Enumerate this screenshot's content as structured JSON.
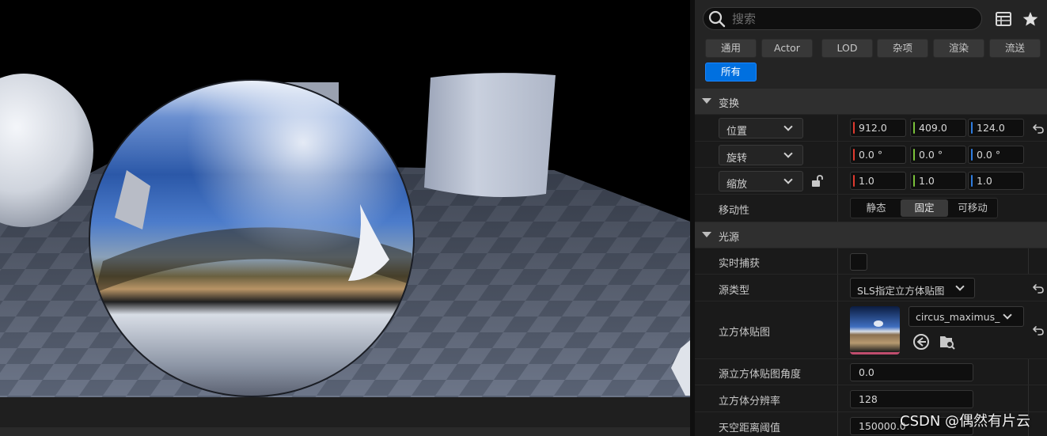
{
  "search": {
    "placeholder": "搜索"
  },
  "toolbar": {
    "table_icon": "table-view-icon",
    "favorite_icon": "star-icon"
  },
  "filters": [
    {
      "label": "通用",
      "active": false
    },
    {
      "label": "Actor",
      "active": false
    },
    {
      "label": "LOD",
      "active": false
    },
    {
      "label": "杂项",
      "active": false
    },
    {
      "label": "渲染",
      "active": false
    },
    {
      "label": "流送",
      "active": false
    },
    {
      "label": "所有",
      "active": true
    }
  ],
  "transform": {
    "header": "变换",
    "location": {
      "label": "位置",
      "x": "912.0",
      "y": "409.0",
      "z": "124.0"
    },
    "rotation": {
      "label": "旋转",
      "x": "0.0 °",
      "y": "0.0 °",
      "z": "0.0 °"
    },
    "scale": {
      "label": "缩放",
      "x": "1.0",
      "y": "1.0",
      "z": "1.0"
    },
    "mobility": {
      "label": "移动性",
      "options": [
        "静态",
        "固定",
        "可移动"
      ],
      "selected": "固定"
    }
  },
  "light": {
    "header": "光源",
    "realtime_capture": {
      "label": "实时捕获",
      "checked": false
    },
    "source_type": {
      "label": "源类型",
      "value": "SLS指定立方体贴图"
    },
    "cubemap": {
      "label": "立方体贴图",
      "value": "circus_maximus_"
    },
    "cubemap_angle": {
      "label": "源立方体贴图角度",
      "value": "0.0"
    },
    "cubemap_resolution": {
      "label": "立方体分辨率",
      "value": "128"
    },
    "sky_distance_threshold": {
      "label": "天空距离阈值",
      "value": "150000.0"
    }
  },
  "axis_colors": {
    "x": "#e03a2f",
    "y": "#7ac23a",
    "z": "#2f7de0"
  },
  "accent_color": "#0070e0",
  "watermark": "CSDN @偶然有片云"
}
